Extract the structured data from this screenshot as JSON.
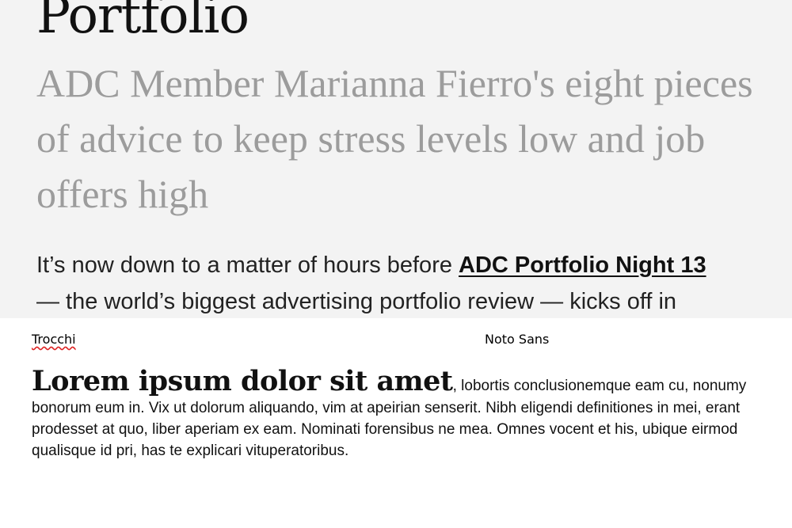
{
  "article": {
    "title": "Portfolio",
    "subtitle": "ADC Member Marianna Fierro's eight pieces of advice to keep stress levels low and job offers high",
    "body_intro": "It’s now down to a matter of hours before ",
    "body_link": "ADC Portfolio Night 13",
    "body_rest": " — the world’s biggest advertising portfolio review — kicks off in"
  },
  "font_comparison": {
    "left_label": "Trocchi",
    "right_label": "Noto Sans",
    "sample_heading": "Lorem ipsum dolor sit amet",
    "sample_text": ", lobortis conclusionemque eam cu, nonumy bonorum eum in. Vix ut dolorum aliquando, vim at apeirian senserit. Nibh eligendi definitiones in mei, erant prodesset at quo, liber aperiam ex eam. Nominati forensibus ne mea. Omnes vocent et his, ubique eirmod qualisque id pri, has te explicari vituperatoribus."
  }
}
